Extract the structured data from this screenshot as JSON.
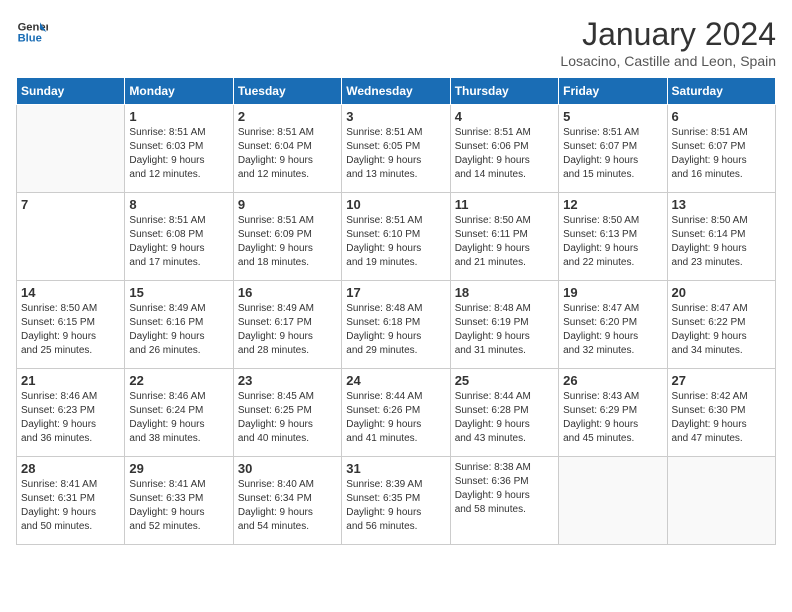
{
  "logo": {
    "line1": "General",
    "line2": "Blue"
  },
  "title": "January 2024",
  "subtitle": "Losacino, Castille and Leon, Spain",
  "weekdays": [
    "Sunday",
    "Monday",
    "Tuesday",
    "Wednesday",
    "Thursday",
    "Friday",
    "Saturday"
  ],
  "weeks": [
    [
      {
        "day": "",
        "info": ""
      },
      {
        "day": "1",
        "info": "Sunrise: 8:51 AM\nSunset: 6:03 PM\nDaylight: 9 hours\nand 12 minutes."
      },
      {
        "day": "2",
        "info": "Sunrise: 8:51 AM\nSunset: 6:04 PM\nDaylight: 9 hours\nand 12 minutes."
      },
      {
        "day": "3",
        "info": "Sunrise: 8:51 AM\nSunset: 6:05 PM\nDaylight: 9 hours\nand 13 minutes."
      },
      {
        "day": "4",
        "info": "Sunrise: 8:51 AM\nSunset: 6:06 PM\nDaylight: 9 hours\nand 14 minutes."
      },
      {
        "day": "5",
        "info": "Sunrise: 8:51 AM\nSunset: 6:07 PM\nDaylight: 9 hours\nand 15 minutes."
      },
      {
        "day": "6",
        "info": "Sunrise: 8:51 AM\nSunset: 6:07 PM\nDaylight: 9 hours\nand 16 minutes."
      }
    ],
    [
      {
        "day": "7",
        "info": ""
      },
      {
        "day": "8",
        "info": "Sunrise: 8:51 AM\nSunset: 6:08 PM\nDaylight: 9 hours\nand 17 minutes."
      },
      {
        "day": "9",
        "info": "Sunrise: 8:51 AM\nSunset: 6:09 PM\nDaylight: 9 hours\nand 18 minutes."
      },
      {
        "day": "10",
        "info": "Sunrise: 8:51 AM\nSunset: 6:10 PM\nDaylight: 9 hours\nand 19 minutes."
      },
      {
        "day": "11",
        "info": "Sunrise: 8:50 AM\nSunset: 6:11 PM\nDaylight: 9 hours\nand 21 minutes."
      },
      {
        "day": "12",
        "info": "Sunrise: 8:50 AM\nSunset: 6:13 PM\nDaylight: 9 hours\nand 22 minutes."
      },
      {
        "day": "13",
        "info": "Sunrise: 8:50 AM\nSunset: 6:14 PM\nDaylight: 9 hours\nand 23 minutes."
      }
    ],
    [
      {
        "day": "14",
        "info": "Sunrise: 8:50 AM\nSunset: 6:15 PM\nDaylight: 9 hours\nand 25 minutes."
      },
      {
        "day": "15",
        "info": "Sunrise: 8:49 AM\nSunset: 6:16 PM\nDaylight: 9 hours\nand 26 minutes."
      },
      {
        "day": "16",
        "info": "Sunrise: 8:49 AM\nSunset: 6:17 PM\nDaylight: 9 hours\nand 28 minutes."
      },
      {
        "day": "17",
        "info": "Sunrise: 8:48 AM\nSunset: 6:18 PM\nDaylight: 9 hours\nand 29 minutes."
      },
      {
        "day": "18",
        "info": "Sunrise: 8:48 AM\nSunset: 6:19 PM\nDaylight: 9 hours\nand 31 minutes."
      },
      {
        "day": "19",
        "info": "Sunrise: 8:47 AM\nSunset: 6:20 PM\nDaylight: 9 hours\nand 32 minutes."
      },
      {
        "day": "20",
        "info": "Sunrise: 8:47 AM\nSunset: 6:22 PM\nDaylight: 9 hours\nand 34 minutes."
      }
    ],
    [
      {
        "day": "21",
        "info": "Sunrise: 8:46 AM\nSunset: 6:23 PM\nDaylight: 9 hours\nand 36 minutes."
      },
      {
        "day": "22",
        "info": "Sunrise: 8:46 AM\nSunset: 6:24 PM\nDaylight: 9 hours\nand 38 minutes."
      },
      {
        "day": "23",
        "info": "Sunrise: 8:45 AM\nSunset: 6:25 PM\nDaylight: 9 hours\nand 40 minutes."
      },
      {
        "day": "24",
        "info": "Sunrise: 8:44 AM\nSunset: 6:26 PM\nDaylight: 9 hours\nand 41 minutes."
      },
      {
        "day": "25",
        "info": "Sunrise: 8:44 AM\nSunset: 6:28 PM\nDaylight: 9 hours\nand 43 minutes."
      },
      {
        "day": "26",
        "info": "Sunrise: 8:43 AM\nSunset: 6:29 PM\nDaylight: 9 hours\nand 45 minutes."
      },
      {
        "day": "27",
        "info": "Sunrise: 8:42 AM\nSunset: 6:30 PM\nDaylight: 9 hours\nand 47 minutes."
      }
    ],
    [
      {
        "day": "28",
        "info": "Sunrise: 8:41 AM\nSunset: 6:31 PM\nDaylight: 9 hours\nand 50 minutes."
      },
      {
        "day": "29",
        "info": "Sunrise: 8:41 AM\nSunset: 6:33 PM\nDaylight: 9 hours\nand 52 minutes."
      },
      {
        "day": "30",
        "info": "Sunrise: 8:40 AM\nSunset: 6:34 PM\nDaylight: 9 hours\nand 54 minutes."
      },
      {
        "day": "31",
        "info": "Sunrise: 8:39 AM\nSunset: 6:35 PM\nDaylight: 9 hours\nand 56 minutes."
      },
      {
        "day": "",
        "info": "Sunrise: 8:38 AM\nSunset: 6:36 PM\nDaylight: 9 hours\nand 58 minutes."
      },
      {
        "day": "",
        "info": ""
      },
      {
        "day": "",
        "info": ""
      }
    ]
  ]
}
